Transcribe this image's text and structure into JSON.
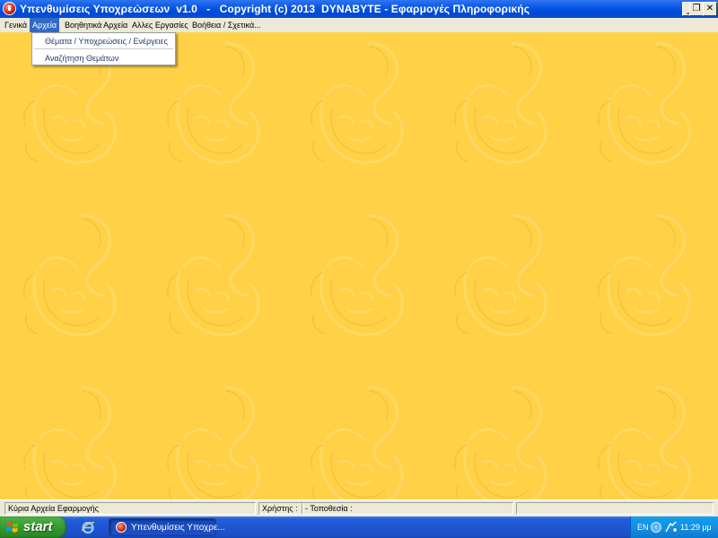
{
  "window": {
    "title": "Υπενθυμίσεις Υποχρεώσεων  v1.0   -   Copyright (c) 2013  DYNABYTE - Εφαρμογές Πληροφορικής",
    "minimize_glyph": "_",
    "restore_glyph": "❐",
    "close_glyph": "✕"
  },
  "menubar": {
    "items": [
      {
        "label": "Γενικά"
      },
      {
        "label": "Αρχεία"
      },
      {
        "label": "Βοηθητικά Αρχεία"
      },
      {
        "label": "Αλλες Εργασίες"
      },
      {
        "label": "Βοήθεια / Σχετικά..."
      }
    ],
    "active_index": 1
  },
  "dropdown": {
    "items": [
      {
        "label": "Θέματα / Υποχρεώσεις / Ενέργειες"
      },
      {
        "label": "Αναζήτηση Θεμάτων"
      }
    ]
  },
  "workspace": {
    "background_color": "#fed147",
    "watermark_icon": "lion-head-watermark-icon"
  },
  "statusbar": {
    "panel_main": "Κύρια Αρχεία Εφαρμογής",
    "panel_user": "Χρήστης :",
    "panel_location": "- Τοποθεσία :",
    "panel_extra": ""
  },
  "taskbar": {
    "start_label": "start",
    "task_label": "Υπενθυμίσεις Υποχρε...",
    "language": "EN",
    "clock": "11:29 μμ"
  },
  "colors": {
    "titlebar": "#0a58e6",
    "menu_highlight": "#316ac5",
    "taskbar": "#245edb",
    "start_button": "#3ea43a",
    "tray": "#1290e3"
  }
}
